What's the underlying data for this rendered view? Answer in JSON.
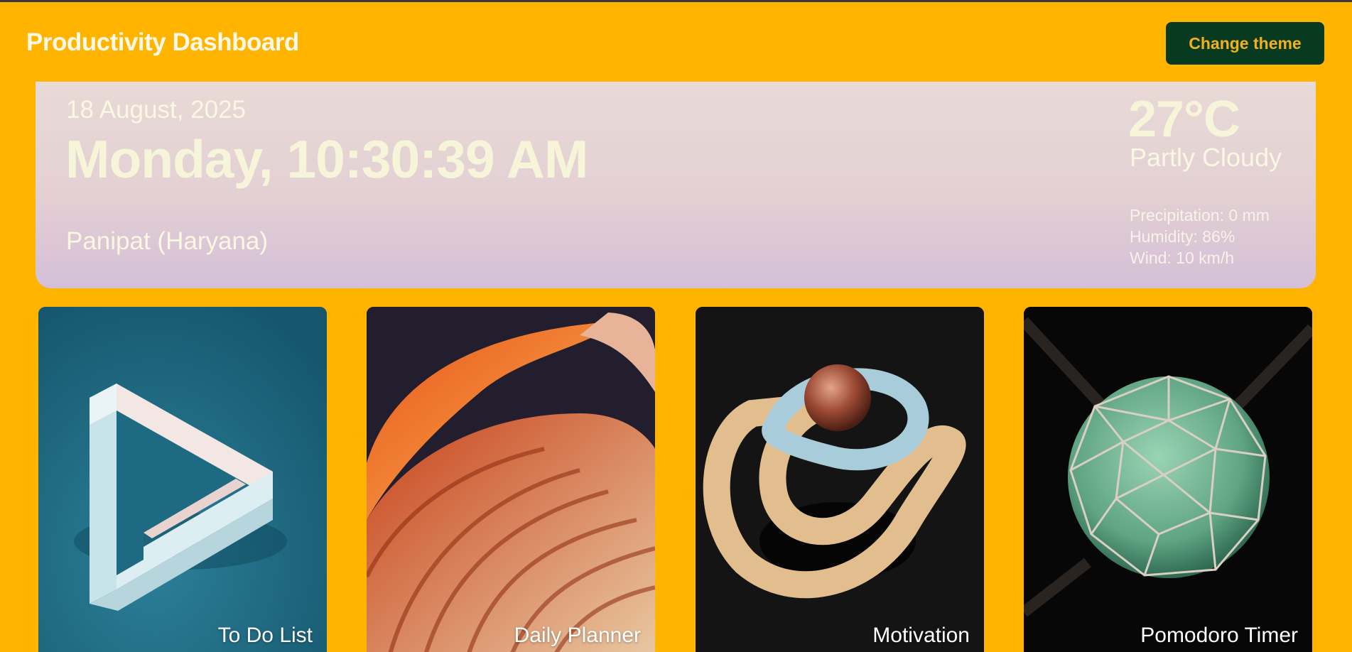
{
  "header": {
    "title": "Productivity Dashboard",
    "theme_button": "Change theme"
  },
  "hero": {
    "date": "18 August, 2025",
    "clock": "Monday, 10:30:39 AM",
    "location": "Panipat (Haryana)"
  },
  "weather": {
    "temperature": "27°C",
    "condition": "Partly Cloudy",
    "precipitation": "Precipitation: 0 mm",
    "humidity": "Humidity: 86%",
    "wind": "Wind: 10 km/h"
  },
  "cards": [
    {
      "label": "To Do List",
      "image": "penrose-triangle-image"
    },
    {
      "label": "Daily Planner",
      "image": "orange-swirl-image"
    },
    {
      "label": "Motivation",
      "image": "abstract-knot-sphere-image"
    },
    {
      "label": "Pomodoro Timer",
      "image": "geodesic-sphere-image"
    }
  ],
  "colors": {
    "background": "#FFB400",
    "button_bg": "#083A1F",
    "button_text": "#F2B01E",
    "hero_text": "#F6F4D9"
  }
}
